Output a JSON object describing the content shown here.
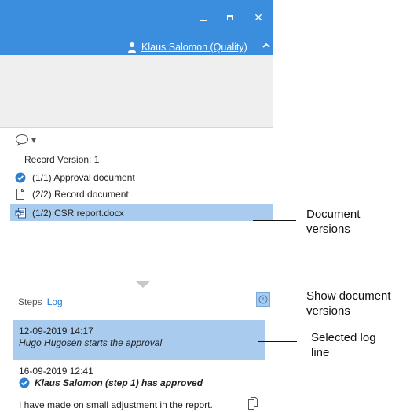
{
  "window": {
    "title_bar_color": "#3b8ddd",
    "controls": [
      "minimize",
      "maximize",
      "close"
    ],
    "close_glyph": "✕"
  },
  "user": {
    "name": "Klaus Salomon (Quality)",
    "icon": "user-icon"
  },
  "comment_menu": {
    "icon": "speech-bubble-icon",
    "dropdown_glyph": "▾"
  },
  "record": {
    "version_label": "Record Version: 1",
    "documents": [
      {
        "label": "(1/1) Approval document",
        "icon": "check-circle-icon"
      },
      {
        "label": "(2/2) Record document",
        "icon": "blank-page-icon"
      },
      {
        "label": "(1/2) CSR report.docx",
        "icon": "word-doc-icon",
        "selected": true
      }
    ]
  },
  "tabs": {
    "steps": "Steps",
    "log": "Log"
  },
  "log": {
    "entries": [
      {
        "date": "12-09-2019 14:17",
        "text": "Hugo Hugosen starts the approval",
        "selected": true
      },
      {
        "date": "16-09-2019 12:41",
        "text": "Klaus Salomon (step 1) has approved",
        "icon": "check-circle-icon"
      }
    ],
    "comment": "I have made on small adjustment in the report."
  },
  "annotations": {
    "document_versions": [
      "Document",
      "versions"
    ],
    "show_versions": [
      "Show document",
      "versions"
    ],
    "selected_log": [
      "Selected log",
      "line"
    ]
  },
  "colors": {
    "accent": "#3b8ddd",
    "selection": "#a9cbee",
    "link": "#1e7cd8",
    "check": "#2f7fd1"
  }
}
